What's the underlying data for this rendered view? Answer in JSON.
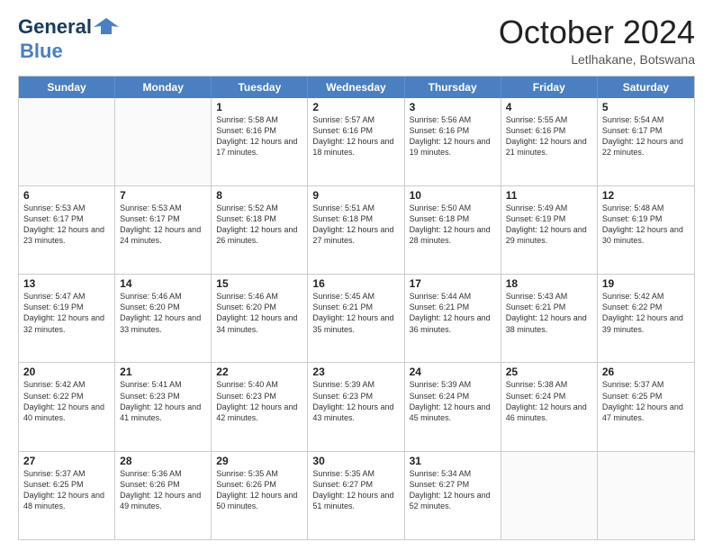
{
  "header": {
    "logo_line1": "General",
    "logo_line2": "Blue",
    "month": "October 2024",
    "location": "Letlhakane, Botswana"
  },
  "days_of_week": [
    "Sunday",
    "Monday",
    "Tuesday",
    "Wednesday",
    "Thursday",
    "Friday",
    "Saturday"
  ],
  "weeks": [
    [
      {
        "day": "",
        "info": ""
      },
      {
        "day": "",
        "info": ""
      },
      {
        "day": "1",
        "info": "Sunrise: 5:58 AM\nSunset: 6:16 PM\nDaylight: 12 hours and 17 minutes."
      },
      {
        "day": "2",
        "info": "Sunrise: 5:57 AM\nSunset: 6:16 PM\nDaylight: 12 hours and 18 minutes."
      },
      {
        "day": "3",
        "info": "Sunrise: 5:56 AM\nSunset: 6:16 PM\nDaylight: 12 hours and 19 minutes."
      },
      {
        "day": "4",
        "info": "Sunrise: 5:55 AM\nSunset: 6:16 PM\nDaylight: 12 hours and 21 minutes."
      },
      {
        "day": "5",
        "info": "Sunrise: 5:54 AM\nSunset: 6:17 PM\nDaylight: 12 hours and 22 minutes."
      }
    ],
    [
      {
        "day": "6",
        "info": "Sunrise: 5:53 AM\nSunset: 6:17 PM\nDaylight: 12 hours and 23 minutes."
      },
      {
        "day": "7",
        "info": "Sunrise: 5:53 AM\nSunset: 6:17 PM\nDaylight: 12 hours and 24 minutes."
      },
      {
        "day": "8",
        "info": "Sunrise: 5:52 AM\nSunset: 6:18 PM\nDaylight: 12 hours and 26 minutes."
      },
      {
        "day": "9",
        "info": "Sunrise: 5:51 AM\nSunset: 6:18 PM\nDaylight: 12 hours and 27 minutes."
      },
      {
        "day": "10",
        "info": "Sunrise: 5:50 AM\nSunset: 6:18 PM\nDaylight: 12 hours and 28 minutes."
      },
      {
        "day": "11",
        "info": "Sunrise: 5:49 AM\nSunset: 6:19 PM\nDaylight: 12 hours and 29 minutes."
      },
      {
        "day": "12",
        "info": "Sunrise: 5:48 AM\nSunset: 6:19 PM\nDaylight: 12 hours and 30 minutes."
      }
    ],
    [
      {
        "day": "13",
        "info": "Sunrise: 5:47 AM\nSunset: 6:19 PM\nDaylight: 12 hours and 32 minutes."
      },
      {
        "day": "14",
        "info": "Sunrise: 5:46 AM\nSunset: 6:20 PM\nDaylight: 12 hours and 33 minutes."
      },
      {
        "day": "15",
        "info": "Sunrise: 5:46 AM\nSunset: 6:20 PM\nDaylight: 12 hours and 34 minutes."
      },
      {
        "day": "16",
        "info": "Sunrise: 5:45 AM\nSunset: 6:21 PM\nDaylight: 12 hours and 35 minutes."
      },
      {
        "day": "17",
        "info": "Sunrise: 5:44 AM\nSunset: 6:21 PM\nDaylight: 12 hours and 36 minutes."
      },
      {
        "day": "18",
        "info": "Sunrise: 5:43 AM\nSunset: 6:21 PM\nDaylight: 12 hours and 38 minutes."
      },
      {
        "day": "19",
        "info": "Sunrise: 5:42 AM\nSunset: 6:22 PM\nDaylight: 12 hours and 39 minutes."
      }
    ],
    [
      {
        "day": "20",
        "info": "Sunrise: 5:42 AM\nSunset: 6:22 PM\nDaylight: 12 hours and 40 minutes."
      },
      {
        "day": "21",
        "info": "Sunrise: 5:41 AM\nSunset: 6:23 PM\nDaylight: 12 hours and 41 minutes."
      },
      {
        "day": "22",
        "info": "Sunrise: 5:40 AM\nSunset: 6:23 PM\nDaylight: 12 hours and 42 minutes."
      },
      {
        "day": "23",
        "info": "Sunrise: 5:39 AM\nSunset: 6:23 PM\nDaylight: 12 hours and 43 minutes."
      },
      {
        "day": "24",
        "info": "Sunrise: 5:39 AM\nSunset: 6:24 PM\nDaylight: 12 hours and 45 minutes."
      },
      {
        "day": "25",
        "info": "Sunrise: 5:38 AM\nSunset: 6:24 PM\nDaylight: 12 hours and 46 minutes."
      },
      {
        "day": "26",
        "info": "Sunrise: 5:37 AM\nSunset: 6:25 PM\nDaylight: 12 hours and 47 minutes."
      }
    ],
    [
      {
        "day": "27",
        "info": "Sunrise: 5:37 AM\nSunset: 6:25 PM\nDaylight: 12 hours and 48 minutes."
      },
      {
        "day": "28",
        "info": "Sunrise: 5:36 AM\nSunset: 6:26 PM\nDaylight: 12 hours and 49 minutes."
      },
      {
        "day": "29",
        "info": "Sunrise: 5:35 AM\nSunset: 6:26 PM\nDaylight: 12 hours and 50 minutes."
      },
      {
        "day": "30",
        "info": "Sunrise: 5:35 AM\nSunset: 6:27 PM\nDaylight: 12 hours and 51 minutes."
      },
      {
        "day": "31",
        "info": "Sunrise: 5:34 AM\nSunset: 6:27 PM\nDaylight: 12 hours and 52 minutes."
      },
      {
        "day": "",
        "info": ""
      },
      {
        "day": "",
        "info": ""
      }
    ]
  ]
}
